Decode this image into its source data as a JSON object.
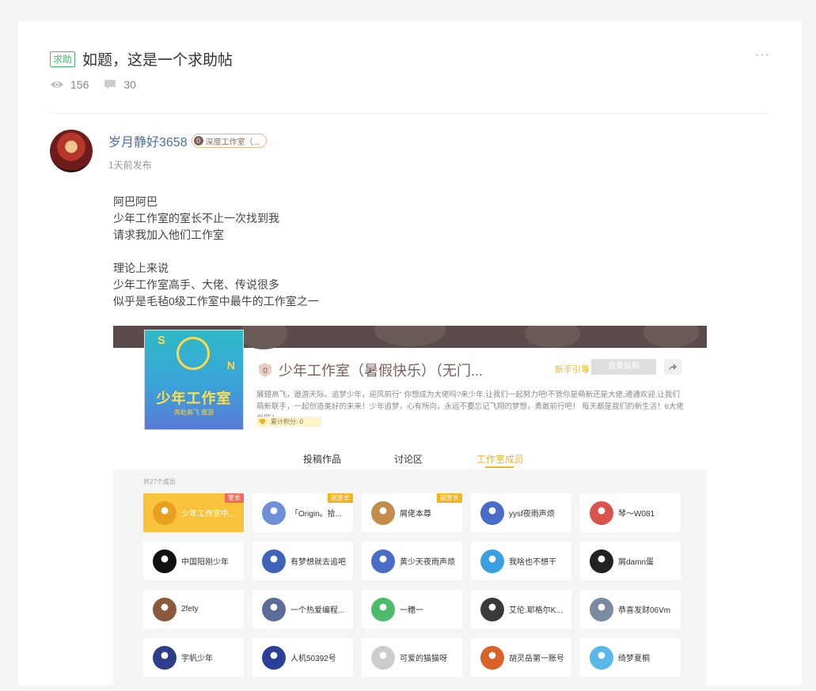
{
  "post": {
    "tag": "求助",
    "title": "如题，这是一个求助帖",
    "more": "···",
    "views": "156",
    "comments": "30"
  },
  "author": {
    "name": "岁月静好3658",
    "studio_level": "0",
    "studio_badge": "深度工作室（...",
    "time": "1天前发布"
  },
  "content": {
    "lines_a": [
      "阿巴阿巴",
      "少年工作室的室长不止一次找到我",
      "请求我加入他们工作室"
    ],
    "lines_b": [
      "理论上来说",
      "少年工作室高手、大佬、传说很多",
      "似乎是毛毡0级工作室中最牛的工作室之一"
    ]
  },
  "studio": {
    "logo_text": "少年工作室",
    "logo_letter_s": "S",
    "logo_letter_n": "N",
    "logo_sub": "奔赴高飞  遨游",
    "level": "0",
    "name": "少年工作室（暑假快乐）（无门...",
    "guide": "新手引导",
    "join": "我要投稿",
    "description": "展翅高飞，遨游天际。追梦少年，迎风前行\" 你想成为大佬吗?来少年,让我们一起努力吧!不管你是萌新还是大佬,通通欢迎,让我们萌新联手，一起创造美好的未来！少年追梦，心有所向，永远不要忘记飞翔的梦想，勇敢前行吧！ 每天都是我们的新生活！6大佬坐阵！",
    "points": "累计积分: 0",
    "tabs": [
      "投稿作品",
      "讨论区",
      "工作室成员"
    ],
    "active_tab": 2,
    "member_count": "共27个成员",
    "members": [
      {
        "name": "少年工作室中...",
        "role": "室长",
        "color": "#e8a020"
      },
      {
        "name": "「Origin。拾...",
        "role": "副室长",
        "color": "#6f8fd6"
      },
      {
        "name": "屑佬本尊",
        "role": "副室长",
        "color": "#c48c4a"
      },
      {
        "name": "yysf夜雨声烦",
        "role": "",
        "color": "#4a6cc9"
      },
      {
        "name": "琴～W081",
        "role": "",
        "color": "#d9534f"
      },
      {
        "name": "中国阳刚少年",
        "role": "",
        "color": "#111111"
      },
      {
        "name": "有梦想就去追吧",
        "role": "",
        "color": "#3f63b8"
      },
      {
        "name": "黄少天夜雨声烦",
        "role": "",
        "color": "#4a6cc9"
      },
      {
        "name": "我啥也不想干",
        "role": "",
        "color": "#3aa0e0"
      },
      {
        "name": "屑damn蛋",
        "role": "",
        "color": "#222222"
      },
      {
        "name": "2fety",
        "role": "",
        "color": "#8a5a3a"
      },
      {
        "name": "一个热爱编程...",
        "role": "",
        "color": "#5a6c9a"
      },
      {
        "name": "一穗一",
        "role": "",
        "color": "#4cbb6a"
      },
      {
        "name": "艾伦.耶格尔K...",
        "role": "",
        "color": "#3a3a3a"
      },
      {
        "name": "恭喜发财06Vm",
        "role": "",
        "color": "#7a8aa0"
      },
      {
        "name": "宇帆少年",
        "role": "",
        "color": "#2d3f8a"
      },
      {
        "name": "人机50392号",
        "role": "",
        "color": "#2a3f9a"
      },
      {
        "name": "可爱的猫猫呀",
        "role": "",
        "color": "#cccccc"
      },
      {
        "name": "胡灵岳第一账号",
        "role": "",
        "color": "#d9622a"
      },
      {
        "name": "绮梦夏桐",
        "role": "",
        "color": "#58b8e8"
      }
    ]
  }
}
